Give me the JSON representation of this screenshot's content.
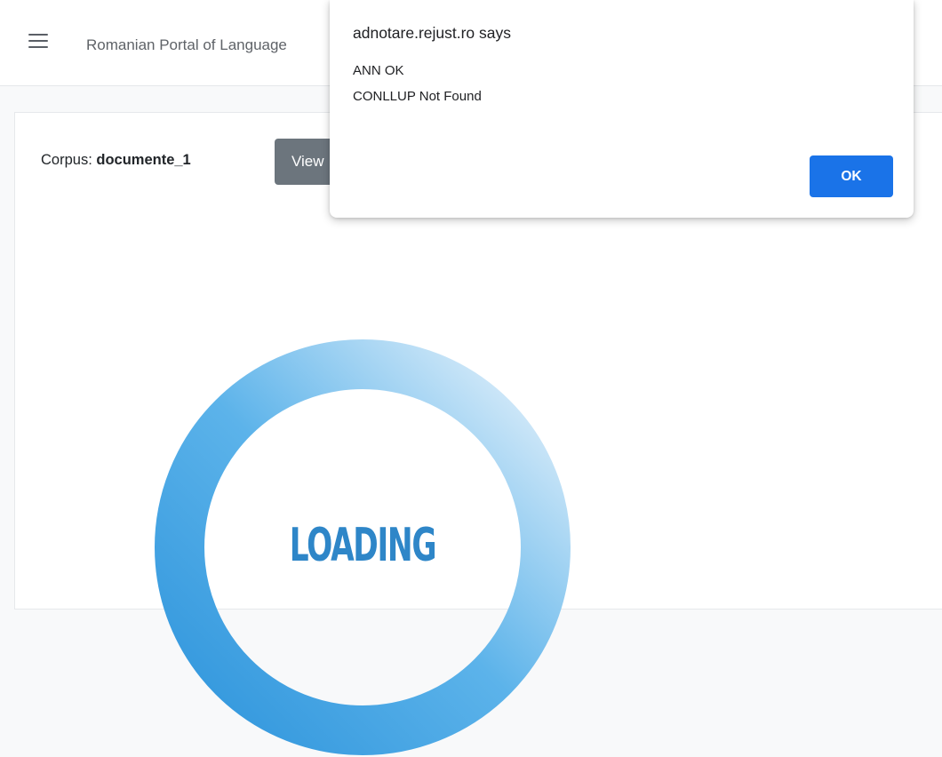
{
  "app": {
    "title": "Romanian Portal of Language"
  },
  "corpus": {
    "label": "Corpus:",
    "name": "documente_1",
    "view_button_label": "View"
  },
  "loader": {
    "text": "LOADING"
  },
  "dialog": {
    "origin": "adnotare.rejust.ro says",
    "lines": [
      "ANN OK",
      "CONLLUP Not Found"
    ],
    "ok_label": "OK"
  },
  "colors": {
    "ok_button": "#1a73e8",
    "view_button": "#6c757d",
    "loading_text": "#2e86c8",
    "ring_dark": "#3a9ee0",
    "ring_light": "#e4f1fb"
  },
  "icons": {
    "menu": "hamburger-menu-icon"
  }
}
